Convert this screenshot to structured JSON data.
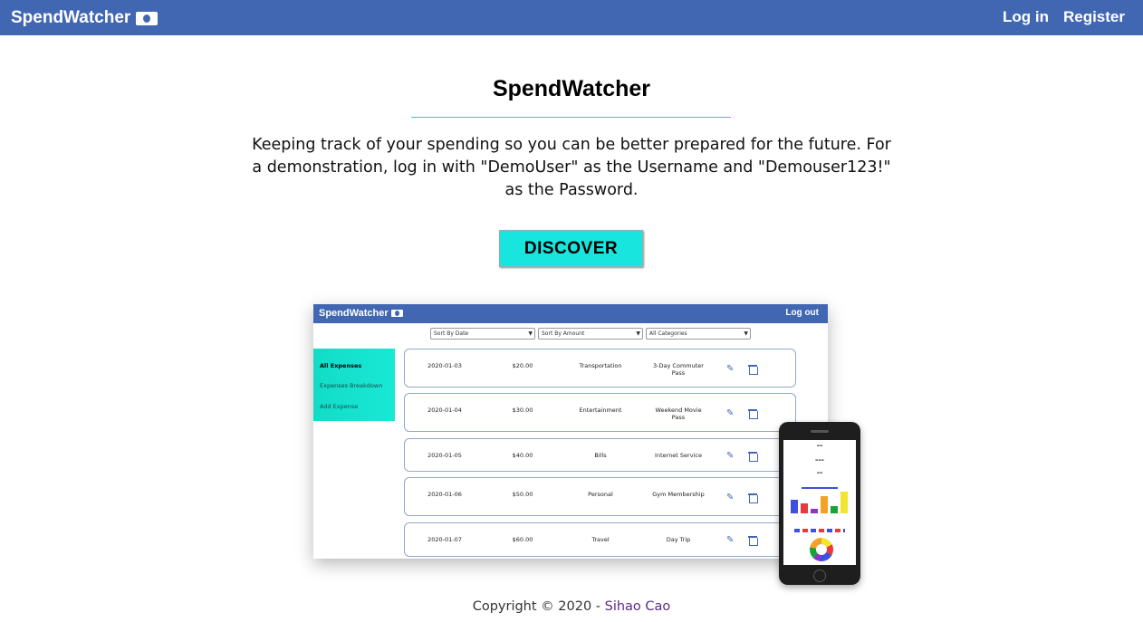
{
  "navbar": {
    "brand": "SpendWatcher",
    "brand_icon": "money-bill-icon",
    "login_label": "Log in",
    "register_label": "Register",
    "bg_color": "#4267b2"
  },
  "hero": {
    "title": "SpendWatcher",
    "tagline": "Keeping track of your spending so you can be better prepared for the future. For a demonstration, log in with \"DemoUser\" as the Username and \"Demouser123!\" as the Password.",
    "discover_label": "DISCOVER",
    "accent_color": "#17e5de"
  },
  "mockup": {
    "brand": "SpendWatcher",
    "logout_label": "Log out",
    "sort_date": "Sort By Date",
    "sort_amount": "Sort By Amount",
    "categories": "All Categories",
    "sidebar": [
      "All Expenses",
      "Expenses Breakdown",
      "Add Expense"
    ],
    "rows": [
      {
        "date": "2020-01-03",
        "amount": "$20.00",
        "category": "Transportation",
        "description": "3-Day Commuter Pass"
      },
      {
        "date": "2020-01-04",
        "amount": "$30.00",
        "category": "Entertainment",
        "description": "Weekend Movie Pass"
      },
      {
        "date": "2020-01-05",
        "amount": "$40.00",
        "category": "Bills",
        "description": "Internet Service"
      },
      {
        "date": "2020-01-06",
        "amount": "$50.00",
        "category": "Personal",
        "description": "Gym Membership"
      },
      {
        "date": "2020-01-07",
        "amount": "$60.00",
        "category": "Travel",
        "description": "Day Trip"
      }
    ]
  },
  "footer": {
    "copyright": "Copyright © 2020 - ",
    "author": "Sihao Cao"
  }
}
